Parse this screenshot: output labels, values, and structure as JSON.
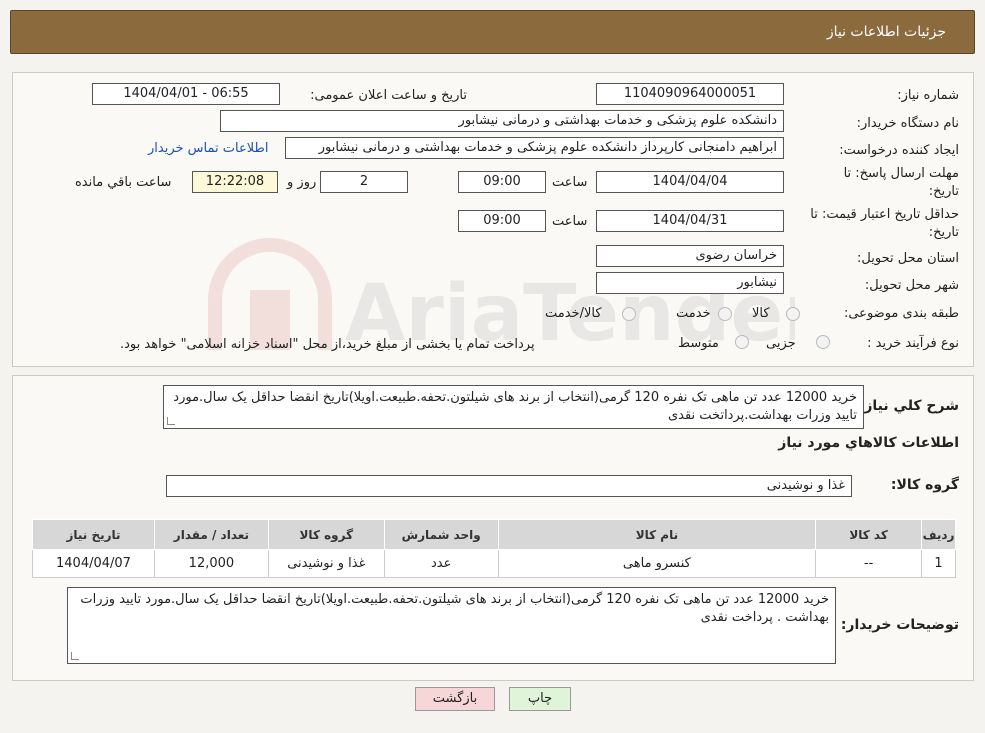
{
  "header": {
    "title": "جزئیات اطلاعات نیاز"
  },
  "fields": {
    "need_number_label": "شماره نیاز:",
    "need_number": "1104090964000051",
    "announce_label": "تاریخ و ساعت اعلان عمومی:",
    "announce_value": "1404/04/01 - 06:55",
    "buyer_org_label": "نام دستگاه خریدار:",
    "buyer_org": "دانشکده علوم پزشکی و خدمات بهداشتی و درمانی نیشابور",
    "requester_label": "ایجاد کننده درخواست:",
    "requester": "ابراهیم دامنجانی  کارپرداز دانشکده علوم پزشکی و خدمات بهداشتی و درمانی نیشابور",
    "contact_link": "اطلاعات تماس خریدار",
    "deadline_label": "مهلت ارسال پاسخ: تا تاریخ:",
    "deadline_date": "1404/04/04",
    "time_label": "ساعت",
    "deadline_time": "09:00",
    "days_value": "2",
    "days_label": "روز و",
    "remaining_time": "12:22:08",
    "remaining_label": "ساعت باقي مانده",
    "validity_label": "حداقل تاریخ اعتبار قیمت: تا تاریخ:",
    "validity_date": "1404/04/31",
    "validity_time": "09:00",
    "province_label": "استان محل تحویل:",
    "province": "خراسان رضوی",
    "city_label": "شهر محل تحویل:",
    "city": "نیشابور",
    "category_label": "طبقه بندی موضوعی:",
    "category_options": [
      "کالا",
      "خدمت",
      "کالا/خدمت"
    ],
    "purchase_type_label": "نوع فرآیند خرید :",
    "purchase_options": [
      "جزیی",
      "متوسط"
    ],
    "purchase_note": "پرداخت تمام یا بخشی از مبلغ خرید،از محل \"اسناد خزانه اسلامی\" خواهد بود."
  },
  "details": {
    "summary_label": "شرح کلي نياز:",
    "summary_text": "خرید 12000 عدد تن ماهی تک نفره 120 گرمی(انتخاب از برند های شیلتون.تحفه.طبیعت.اویلا)تاریخ انقضا حداقل یک سال.مورد تایید وزرات بهداشت.پرداتخت نقدی",
    "goods_info_title": "اطلاعات کالاهاي مورد نياز",
    "group_label": "گروه کالا:",
    "group_value": "غذا و نوشیدنی",
    "table": {
      "headers": [
        "ردیف",
        "کد کالا",
        "نام کالا",
        "واحد شمارش",
        "گروه کالا",
        "تعداد / مقدار",
        "تاریخ نیاز"
      ],
      "rows": [
        [
          "1",
          "--",
          "کنسرو ماهی",
          "عدد",
          "غذا و نوشیدنی",
          "12,000",
          "1404/04/07"
        ]
      ]
    },
    "buyer_notes_label": "توضیحات خریدار:",
    "buyer_notes": "خرید 12000 عدد تن ماهی تک نفره 120 گرمی(انتخاب از برند های شیلتون.تحفه.طبیعت.اویلا)تاریخ انقضا حداقل یک سال.مورد تایید وزرات بهداشت . پرداخت نقدی"
  },
  "buttons": {
    "print": "چاپ",
    "back": "بازگشت"
  },
  "watermark": "AriaTender.net",
  "colors": {
    "header": "#8b6a3e",
    "link": "#1a4fbf",
    "back_button": "#f6d6d6",
    "print_button": "#dff4d8"
  }
}
